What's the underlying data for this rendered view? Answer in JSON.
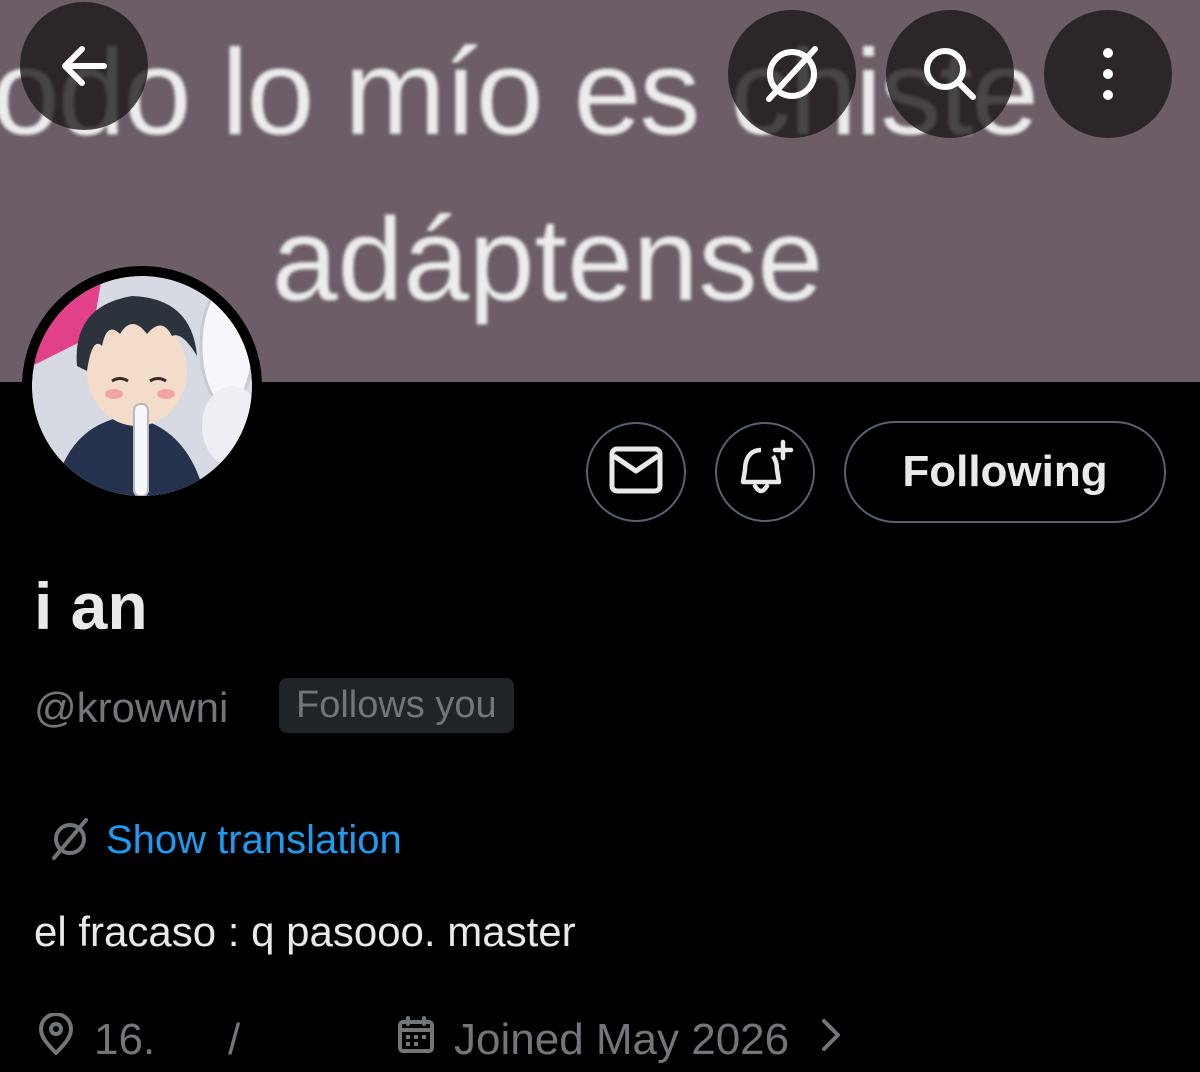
{
  "banner": {
    "line1": "todo lo mío es chiste",
    "line2": "adáptense",
    "background_color": "#6c5d66"
  },
  "top_bar": {
    "back_icon": "arrow-left-icon",
    "translate_icon": "translate-icon",
    "search_icon": "search-icon",
    "more_icon": "more-vertical-icon"
  },
  "profile": {
    "display_name": "i an",
    "handle": "@krowwni",
    "follows_you": "Follows you",
    "show_translation": "Show translation",
    "bio": "el fracaso : q pasooo. master",
    "location": "16.",
    "location_separator": "/",
    "joined": "Joined May 2026"
  },
  "actions": {
    "message_icon": "envelope-icon",
    "notify_icon": "bell-plus-icon",
    "following_label": "Following"
  },
  "colors": {
    "accent_blue": "#1d9bf0",
    "secondary_text": "#71767b",
    "primary_text": "#e7e9ea",
    "border": "#536471",
    "badge_bg": "#202327"
  }
}
